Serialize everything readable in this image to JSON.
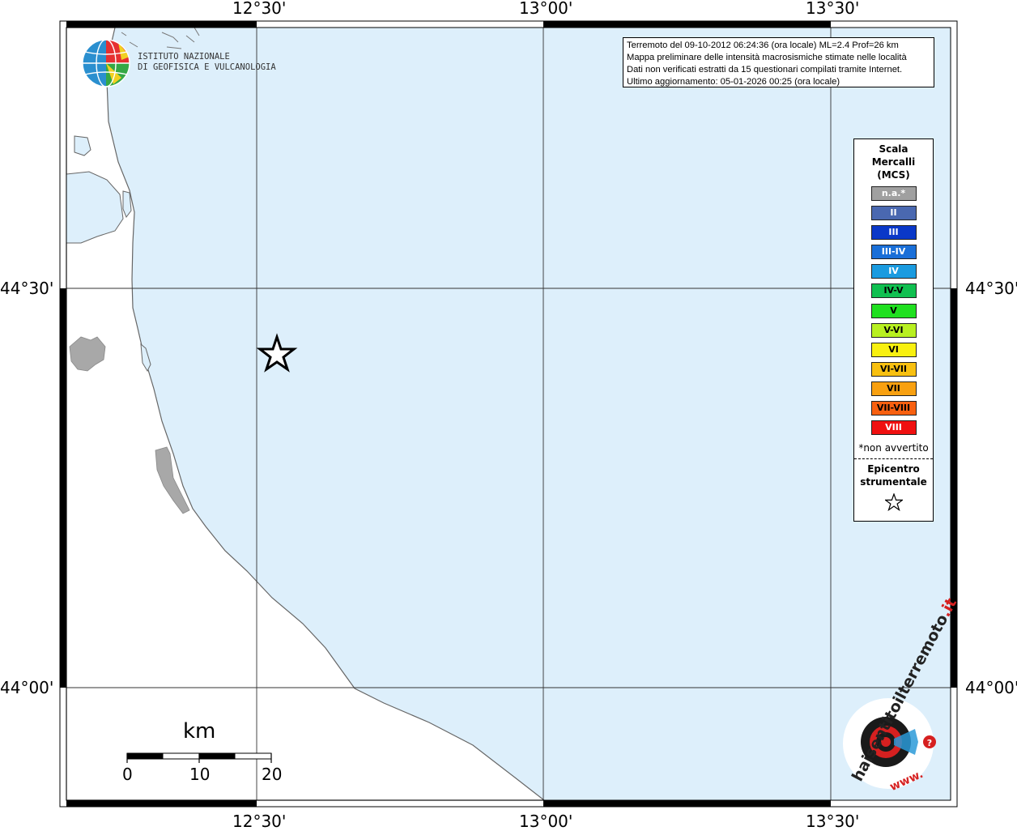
{
  "map": {
    "lon_labels": [
      "12°30'",
      "13°00'",
      "13°30'"
    ],
    "lat_labels": [
      "44°30'",
      "44°00'"
    ],
    "sea_color": "#ddeffb",
    "land_color": "#ffffff",
    "urban_color": "#a8a8a8"
  },
  "info": {
    "line1": "Terremoto del 09-10-2012 06:24:36 (ora locale) ML=2.4 Prof=26 km",
    "line2": "Mappa preliminare delle intensità macrosismiche stimate nelle località",
    "line3": "Dati non verificati estratti da 15 questionari compilati tramite Internet.",
    "line4": "Ultimo aggiornamento: 05-01-2026 00:25 (ora locale)"
  },
  "legend": {
    "title_line1": "Scala",
    "title_line2": "Mercalli",
    "title_line3": "(MCS)",
    "items": [
      {
        "label": "n.a.*",
        "color": "#a0a0a0",
        "text_color": "#ffffff"
      },
      {
        "label": "II",
        "color": "#4a68b0",
        "text_color": "#ffffff"
      },
      {
        "label": "III",
        "color": "#0a38c8",
        "text_color": "#ffffff"
      },
      {
        "label": "III-IV",
        "color": "#1a6fd8",
        "text_color": "#ffffff"
      },
      {
        "label": "IV",
        "color": "#1a9be0",
        "text_color": "#ffffff"
      },
      {
        "label": "IV-V",
        "color": "#10c050",
        "text_color": "#000000"
      },
      {
        "label": "V",
        "color": "#20e020",
        "text_color": "#000000"
      },
      {
        "label": "V-VI",
        "color": "#b8f020",
        "text_color": "#000000"
      },
      {
        "label": "VI",
        "color": "#f8f010",
        "text_color": "#000000"
      },
      {
        "label": "VI-VII",
        "color": "#f8c010",
        "text_color": "#000000"
      },
      {
        "label": "VII",
        "color": "#f8a010",
        "text_color": "#000000"
      },
      {
        "label": "VII-VIII",
        "color": "#f86010",
        "text_color": "#000000"
      },
      {
        "label": "VIII",
        "color": "#f01010",
        "text_color": "#ffffff"
      }
    ],
    "note": "*non avvertito",
    "epi_line1": "Epicentro",
    "epi_line2": "strumentale",
    "star_glyph": "☆"
  },
  "ingv": {
    "line1": "ISTITUTO NAZIONALE",
    "line2": "DI GEOFISICA E VULCANOLOGIA"
  },
  "scalebar": {
    "title": "km",
    "labels": [
      "0",
      "10",
      "20"
    ]
  },
  "hsit_logo": {
    "text_main": "haisentitoilterremoto",
    "text_it": ".it",
    "text_www": "www."
  },
  "epicenter": {
    "icon": "star-icon"
  }
}
